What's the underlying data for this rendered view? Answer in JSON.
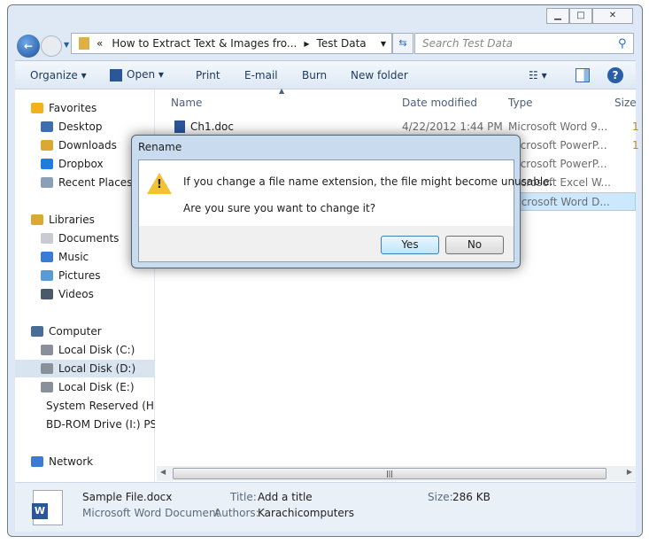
{
  "address": {
    "overflow": "«",
    "segments": [
      "How to Extract Text & Images fro...",
      "Test Data"
    ]
  },
  "search": {
    "placeholder": "Search Test Data"
  },
  "toolbar": {
    "organize": "Organize",
    "open": "Open",
    "print": "Print",
    "email": "E-mail",
    "burn": "Burn",
    "new_folder": "New folder"
  },
  "sidebar": {
    "items": [
      {
        "label": "Favorites",
        "icon": "star-icon",
        "color": "#f2b21b",
        "group": true
      },
      {
        "label": "Desktop",
        "icon": "desktop-icon",
        "color": "#3d6fb0"
      },
      {
        "label": "Downloads",
        "icon": "downloads-folder-icon",
        "color": "#d9a933"
      },
      {
        "label": "Dropbox",
        "icon": "dropbox-icon",
        "color": "#1f7ce0"
      },
      {
        "label": "Recent Places",
        "icon": "recent-places-icon",
        "color": "#8aa0b8"
      },
      {
        "label": "Libraries",
        "icon": "libraries-icon",
        "color": "#d9a933",
        "group": true
      },
      {
        "label": "Documents",
        "icon": "documents-icon",
        "color": "#c8ccd2"
      },
      {
        "label": "Music",
        "icon": "music-icon",
        "color": "#3a7bd5"
      },
      {
        "label": "Pictures",
        "icon": "pictures-icon",
        "color": "#5b9bd5"
      },
      {
        "label": "Videos",
        "icon": "videos-icon",
        "color": "#4a5a6a"
      },
      {
        "label": "Computer",
        "icon": "computer-icon",
        "color": "#4a6d95",
        "group": true
      },
      {
        "label": "Local Disk (C:)",
        "icon": "drive-icon",
        "color": "#8a9099"
      },
      {
        "label": "Local Disk (D:)",
        "icon": "drive-icon",
        "color": "#8a9099",
        "selected": true
      },
      {
        "label": "Local Disk (E:)",
        "icon": "drive-icon",
        "color": "#8a9099"
      },
      {
        "label": "System Reserved (H:",
        "icon": "drive-icon",
        "color": "#8a9099"
      },
      {
        "label": "BD-ROM Drive (I:) PS",
        "icon": "disc-icon",
        "color": "#999"
      },
      {
        "label": "Network",
        "icon": "network-icon",
        "color": "#3a7bd5",
        "group": true
      }
    ]
  },
  "columns": {
    "name": "Name",
    "date": "Date modified",
    "type": "Type",
    "size": "Size"
  },
  "files": [
    {
      "name": "Ch1.doc",
      "date": "4/22/2012 1:44 PM",
      "type": "Microsoft Word 9...",
      "size": "1"
    },
    {
      "name": "",
      "date": "",
      "type": "Microsoft PowerP...",
      "size": "1"
    },
    {
      "name": "",
      "date": "",
      "type": "Microsoft PowerP...",
      "size": ""
    },
    {
      "name": "",
      "date": "",
      "type": "Microsoft Excel W...",
      "size": ""
    },
    {
      "name": "",
      "date": "",
      "type": "Microsoft Word D...",
      "size": "",
      "selected": true
    }
  ],
  "details": {
    "filename": "Sample File.docx",
    "filetype": "Microsoft Word Document",
    "title_label": "Title:",
    "title_value": "Add a title",
    "authors_label": "Authors:",
    "authors_value": "Karachicomputers",
    "size_label": "Size:",
    "size_value": "286 KB"
  },
  "dialog": {
    "title": "Rename",
    "message": "If you change a file name extension, the file might become unusable.",
    "question": "Are you sure you want to change it?",
    "yes": "Yes",
    "no": "No"
  }
}
